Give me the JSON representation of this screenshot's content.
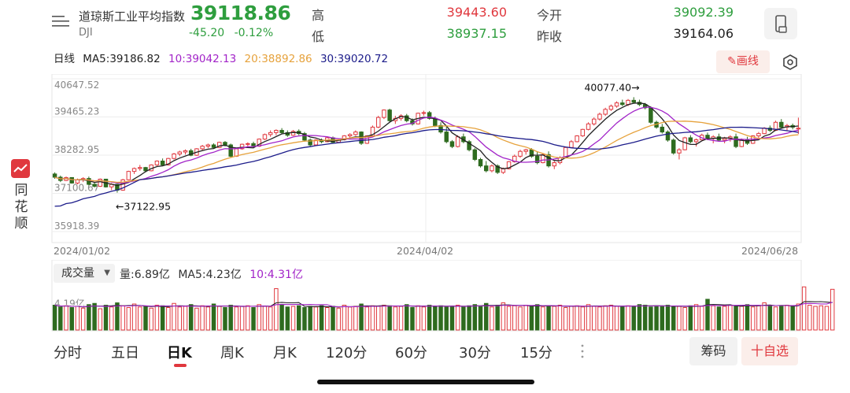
{
  "header": {
    "name": "道琼斯工业平均指数",
    "code": "DJI",
    "price": "39118.86",
    "change": "-45.20",
    "change_pct": "-0.12%",
    "high_label": "高",
    "high_value": "39443.60",
    "low_label": "低",
    "low_value": "38937.15",
    "open_label": "今开",
    "open_value": "39092.39",
    "prev_close_label": "昨收",
    "prev_close_value": "39164.06",
    "icons": {
      "menu": "menu-lines-icon",
      "device": "phone-icon"
    }
  },
  "ma_row": {
    "period": "日线",
    "ma5": "MA5:39186.82",
    "ma10": "10:39042.13",
    "ma20": "20:38892.86",
    "ma30": "30:39020.72",
    "draw_label": "画线",
    "icons": {
      "draw": "pencil-icon",
      "settings": "hexagon-settings-icon"
    }
  },
  "sidebar": {
    "label": "同花顺",
    "icon": "ths-logo-icon"
  },
  "colors": {
    "up": "#e0383e",
    "down": "#2e6b1f",
    "ma5": "#222222",
    "ma10": "#a224c8",
    "ma20": "#e6a23c",
    "ma30": "#1c1c8a",
    "accent": "#e0383e"
  },
  "chart_data": [
    {
      "type": "candlestick",
      "y_ticks": [
        "40647.52",
        "39465.23",
        "38282.95",
        "37100.67",
        "35918.39"
      ],
      "ylim": [
        35918.39,
        40647.52
      ],
      "x_ticks": [
        "2024/01/02",
        "2024/04/02",
        "2024/06/28"
      ],
      "annotations": [
        {
          "text": "40077.40→",
          "value": 40077.4,
          "index": 103
        },
        {
          "text": "←37122.95",
          "value": 37122.95,
          "index": 11
        }
      ],
      "ohlc": [
        [
          37700,
          37750,
          37550,
          37600
        ],
        [
          37600,
          37650,
          37450,
          37500
        ],
        [
          37500,
          37620,
          37480,
          37590
        ],
        [
          37590,
          37600,
          37400,
          37420
        ],
        [
          37420,
          37560,
          37380,
          37520
        ],
        [
          37520,
          37600,
          37450,
          37560
        ],
        [
          37560,
          37620,
          37350,
          37380
        ],
        [
          37380,
          37430,
          37280,
          37320
        ],
        [
          37320,
          37560,
          37300,
          37540
        ],
        [
          37540,
          37550,
          37280,
          37300
        ],
        [
          37300,
          37420,
          37200,
          37380
        ],
        [
          37380,
          37400,
          37122.95,
          37200
        ],
        [
          37200,
          37550,
          37180,
          37520
        ],
        [
          37520,
          37800,
          37500,
          37780
        ],
        [
          37780,
          37900,
          37700,
          37870
        ],
        [
          37870,
          37980,
          37800,
          37900
        ],
        [
          37900,
          37920,
          37750,
          37800
        ],
        [
          37800,
          38000,
          37780,
          37980
        ],
        [
          37980,
          38120,
          37950,
          38100
        ],
        [
          38100,
          38180,
          37950,
          37980
        ],
        [
          37980,
          38200,
          37960,
          38180
        ],
        [
          38180,
          38350,
          38150,
          38320
        ],
        [
          38320,
          38420,
          38250,
          38380
        ],
        [
          38380,
          38460,
          38300,
          38420
        ],
        [
          38420,
          38480,
          38250,
          38280
        ],
        [
          38280,
          38500,
          38260,
          38480
        ],
        [
          38480,
          38600,
          38420,
          38560
        ],
        [
          38560,
          38640,
          38500,
          38600
        ],
        [
          38600,
          38650,
          38480,
          38520
        ],
        [
          38520,
          38700,
          38500,
          38680
        ],
        [
          38680,
          38720,
          38550,
          38600
        ],
        [
          38600,
          38640,
          38200,
          38250
        ],
        [
          38250,
          38500,
          38230,
          38480
        ],
        [
          38480,
          38640,
          38450,
          38620
        ],
        [
          38620,
          38680,
          38550,
          38640
        ],
        [
          38640,
          38700,
          38520,
          38560
        ],
        [
          38560,
          38800,
          38540,
          38780
        ],
        [
          38780,
          38950,
          38750,
          38920
        ],
        [
          38920,
          39050,
          38850,
          38980
        ],
        [
          38980,
          39080,
          38900,
          39050
        ],
        [
          39050,
          39120,
          38950,
          38980
        ],
        [
          38980,
          39050,
          38850,
          38900
        ],
        [
          38900,
          39060,
          38880,
          39020
        ],
        [
          39020,
          39080,
          38900,
          38950
        ],
        [
          38950,
          39000,
          38700,
          38750
        ],
        [
          38750,
          38800,
          38550,
          38600
        ],
        [
          38600,
          38780,
          38580,
          38750
        ],
        [
          38750,
          38800,
          38650,
          38700
        ],
        [
          38700,
          38850,
          38680,
          38820
        ],
        [
          38820,
          38860,
          38650,
          38680
        ],
        [
          38680,
          38800,
          38660,
          38760
        ],
        [
          38760,
          38900,
          38740,
          38880
        ],
        [
          38880,
          38960,
          38800,
          38920
        ],
        [
          38920,
          39050,
          38880,
          39000
        ],
        [
          39000,
          39020,
          38600,
          38650
        ],
        [
          38650,
          38900,
          38630,
          38880
        ],
        [
          38880,
          39200,
          38860,
          39150
        ],
        [
          39150,
          39500,
          39120,
          39450
        ],
        [
          39450,
          39700,
          39400,
          39680
        ],
        [
          39680,
          39720,
          39300,
          39350
        ],
        [
          39350,
          39500,
          39250,
          39420
        ],
        [
          39420,
          39550,
          39350,
          39500
        ],
        [
          39500,
          39560,
          39300,
          39350
        ],
        [
          39350,
          39420,
          39200,
          39250
        ],
        [
          39250,
          39600,
          39230,
          39580
        ],
        [
          39580,
          39660,
          39500,
          39600
        ],
        [
          39600,
          39650,
          39380,
          39420
        ],
        [
          39420,
          39480,
          39150,
          39200
        ],
        [
          39200,
          39300,
          38950,
          39000
        ],
        [
          39000,
          39200,
          38650,
          38700
        ],
        [
          38700,
          38750,
          38500,
          38550
        ],
        [
          38550,
          38900,
          38520,
          38850
        ],
        [
          38850,
          38950,
          38650,
          38700
        ],
        [
          38700,
          38750,
          38400,
          38450
        ],
        [
          38450,
          38500,
          38100,
          38150
        ],
        [
          38150,
          38200,
          37900,
          37950
        ],
        [
          37950,
          38100,
          37750,
          37800
        ],
        [
          37800,
          38000,
          37750,
          37950
        ],
        [
          37950,
          38000,
          37700,
          37750
        ],
        [
          37750,
          37900,
          37700,
          37860
        ],
        [
          37860,
          38100,
          37840,
          38080
        ],
        [
          38080,
          38300,
          38050,
          38250
        ],
        [
          38250,
          38450,
          38200,
          38400
        ],
        [
          38400,
          38480,
          38300,
          38450
        ],
        [
          38450,
          38500,
          38200,
          38250
        ],
        [
          38250,
          38400,
          38000,
          38050
        ],
        [
          38050,
          38350,
          38030,
          38300
        ],
        [
          38300,
          38400,
          37900,
          37950
        ],
        [
          37950,
          38100,
          37850,
          38050
        ],
        [
          38050,
          38250,
          38000,
          38200
        ],
        [
          38200,
          38550,
          38180,
          38520
        ],
        [
          38520,
          38750,
          38500,
          38700
        ],
        [
          38700,
          38900,
          38680,
          38880
        ],
        [
          38880,
          39100,
          38850,
          39080
        ],
        [
          39080,
          39300,
          39050,
          39250
        ],
        [
          39250,
          39450,
          39200,
          39400
        ],
        [
          39400,
          39600,
          39350,
          39550
        ],
        [
          39550,
          39750,
          39500,
          39700
        ],
        [
          39700,
          39850,
          39650,
          39800
        ],
        [
          39800,
          39950,
          39750,
          39900
        ],
        [
          39900,
          40000,
          39800,
          39850
        ],
        [
          39850,
          40020,
          39800,
          39980
        ],
        [
          39980,
          40077.4,
          39900,
          39920
        ],
        [
          39920,
          40000,
          39800,
          39850
        ],
        [
          39850,
          39900,
          39700,
          39750
        ],
        [
          39750,
          39800,
          39250,
          39300
        ],
        [
          39300,
          39350,
          39100,
          39150
        ],
        [
          39150,
          39250,
          38950,
          39000
        ],
        [
          39000,
          39050,
          38700,
          38750
        ],
        [
          38750,
          38800,
          38300,
          38350
        ],
        [
          38350,
          38500,
          38150,
          38450
        ],
        [
          38450,
          38850,
          38430,
          38820
        ],
        [
          38820,
          38900,
          38650,
          38700
        ],
        [
          38700,
          38800,
          38550,
          38760
        ],
        [
          38760,
          38950,
          38740,
          38900
        ],
        [
          38900,
          38980,
          38750,
          38800
        ],
        [
          38800,
          38900,
          38650,
          38850
        ],
        [
          38850,
          38950,
          38700,
          38750
        ],
        [
          38750,
          38850,
          38650,
          38800
        ],
        [
          38800,
          38900,
          38700,
          38850
        ],
        [
          38850,
          38950,
          38500,
          38550
        ],
        [
          38550,
          38800,
          38530,
          38760
        ],
        [
          38760,
          38850,
          38600,
          38650
        ],
        [
          38650,
          38900,
          38630,
          38880
        ],
        [
          38880,
          39000,
          38800,
          38950
        ],
        [
          38950,
          39150,
          38930,
          39120
        ],
        [
          39120,
          39200,
          39000,
          39050
        ],
        [
          39050,
          39350,
          39030,
          39300
        ],
        [
          39300,
          39400,
          39100,
          39150
        ],
        [
          39150,
          39250,
          39050,
          39200
        ],
        [
          39200,
          39260,
          39080,
          39150
        ],
        [
          39092.39,
          39443.6,
          38937.15,
          39118.86
        ]
      ],
      "ma": {
        "periods": [
          5,
          10,
          20,
          30
        ]
      }
    },
    {
      "type": "bar",
      "title": "成交量",
      "y_ticks": [
        "4.19亿"
      ],
      "volume_info": {
        "vol": "量:6.89亿",
        "ma5": "MA5:4.23亿",
        "ma10": "10:4.31亿"
      },
      "volumes": [
        4.2,
        3.9,
        4.1,
        3.8,
        4.0,
        3.7,
        4.3,
        4.5,
        3.6,
        4.2,
        3.9,
        4.6,
        4.1,
        3.8,
        4.4,
        3.9,
        4.0,
        3.7,
        4.2,
        4.1,
        3.8,
        4.5,
        3.9,
        4.0,
        4.3,
        3.7,
        4.1,
        3.9,
        4.4,
        4.0,
        3.8,
        4.2,
        3.9,
        4.0,
        4.1,
        3.8,
        4.3,
        4.0,
        3.9,
        7.0,
        4.2,
        3.9,
        4.0,
        4.1,
        3.8,
        4.0,
        3.9,
        4.1,
        3.8,
        4.0,
        3.7,
        4.2,
        3.9,
        4.0,
        4.4,
        3.9,
        4.1,
        4.0,
        4.2,
        4.1,
        3.9,
        4.0,
        4.3,
        3.8,
        4.1,
        3.9,
        4.2,
        4.0,
        4.1,
        3.9,
        4.0,
        4.2,
        3.9,
        4.1,
        4.3,
        4.0,
        4.5,
        3.9,
        4.2,
        4.6,
        4.0,
        4.1,
        3.9,
        4.2,
        4.0,
        4.3,
        3.9,
        4.1,
        4.0,
        4.2,
        3.8,
        4.0,
        4.1,
        3.9,
        4.3,
        4.0,
        3.9,
        4.1,
        4.2,
        4.0,
        3.9,
        4.1,
        4.0,
        4.3,
        4.2,
        3.9,
        4.1,
        4.0,
        4.2,
        3.9,
        4.0,
        3.8,
        4.1,
        4.3,
        4.0,
        5.2,
        4.1,
        3.9,
        4.0,
        4.2,
        4.1,
        4.0,
        4.3,
        3.9,
        4.2,
        4.6,
        4.1,
        3.9,
        4.0,
        4.2,
        4.0,
        4.4,
        7.3,
        4.2,
        4.0,
        4.1,
        4.0,
        6.89
      ]
    }
  ],
  "tabs": [
    {
      "label": "分时"
    },
    {
      "label": "五日"
    },
    {
      "label": "日K"
    },
    {
      "label": "周K"
    },
    {
      "label": "月K"
    },
    {
      "label": "120分"
    },
    {
      "label": "60分"
    },
    {
      "label": "30分"
    },
    {
      "label": "15分"
    }
  ],
  "tab_more_icon": "vertical-dots-icon",
  "chip_label": "筹码",
  "watch_label": "十自选"
}
